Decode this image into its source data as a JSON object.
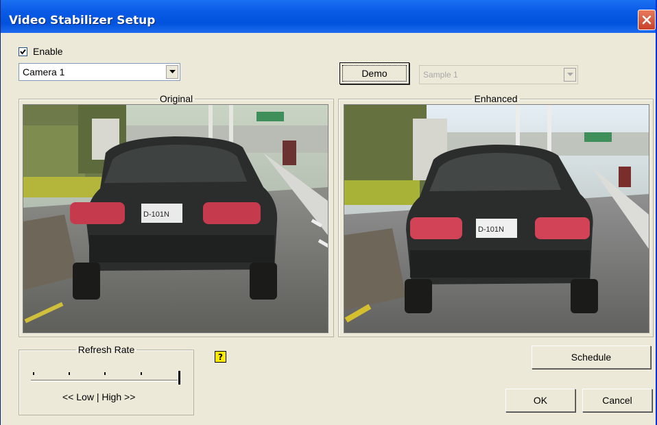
{
  "window": {
    "title": "Video Stabilizer Setup"
  },
  "enable": {
    "label": "Enable",
    "checked": true
  },
  "camera_select": {
    "value": "Camera 1"
  },
  "demo_button": {
    "label": "Demo"
  },
  "sample_select": {
    "value": "Sample 1",
    "enabled": false
  },
  "panels": {
    "original": "Original",
    "enhanced": "Enhanced"
  },
  "refresh_rate": {
    "title": "Refresh Rate",
    "scale_label": "<< Low | High >>",
    "level": 1.0
  },
  "buttons": {
    "schedule": "Schedule",
    "ok": "OK",
    "cancel": "Cancel"
  },
  "help": {
    "glyph": "?"
  },
  "plate_text": "D-101N"
}
